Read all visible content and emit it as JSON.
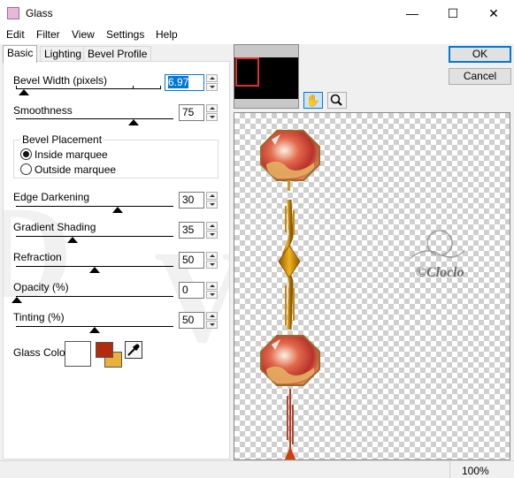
{
  "window": {
    "title": "Glass",
    "minimize": "—",
    "maximize": "☐",
    "close": "✕"
  },
  "menu": [
    "Edit",
    "Filter",
    "View",
    "Settings",
    "Help"
  ],
  "tabs": [
    "Basic",
    "Lighting",
    "Bevel Profile"
  ],
  "controls": {
    "bevel_width": {
      "label": "Bevel Width (pixels)",
      "value": "6.97",
      "level": 0.05
    },
    "smoothness": {
      "label": "Smoothness",
      "value": "75",
      "level": 0.75
    },
    "bevel_placement": {
      "label": "Bevel Placement",
      "options": [
        "Inside marquee",
        "Outside marquee"
      ],
      "selected": "Inside marquee"
    },
    "edge_darkening": {
      "label": "Edge Darkening",
      "value": "30",
      "level": 0.3
    },
    "gradient_shading": {
      "label": "Gradient Shading",
      "value": "35",
      "level": 0.35
    },
    "refraction": {
      "label": "Refraction",
      "value": "50",
      "level": 0.5
    },
    "opacity": {
      "label": "Opacity (%)",
      "value": "0",
      "level": 0
    },
    "tinting": {
      "label": "Tinting (%)",
      "value": "50",
      "level": 0.5
    },
    "glass_color": {
      "label": "Glass Color",
      "swatch": "#ffffff",
      "foreground": "#b32a0c",
      "background": "#e8b23a"
    }
  },
  "buttons": {
    "ok": "OK",
    "cancel": "Cancel"
  },
  "watermark": "©Cloclo",
  "status": {
    "zoom": "100%"
  },
  "colors": {
    "accent": "#0078d7",
    "navigator_frame": "#e03030"
  }
}
